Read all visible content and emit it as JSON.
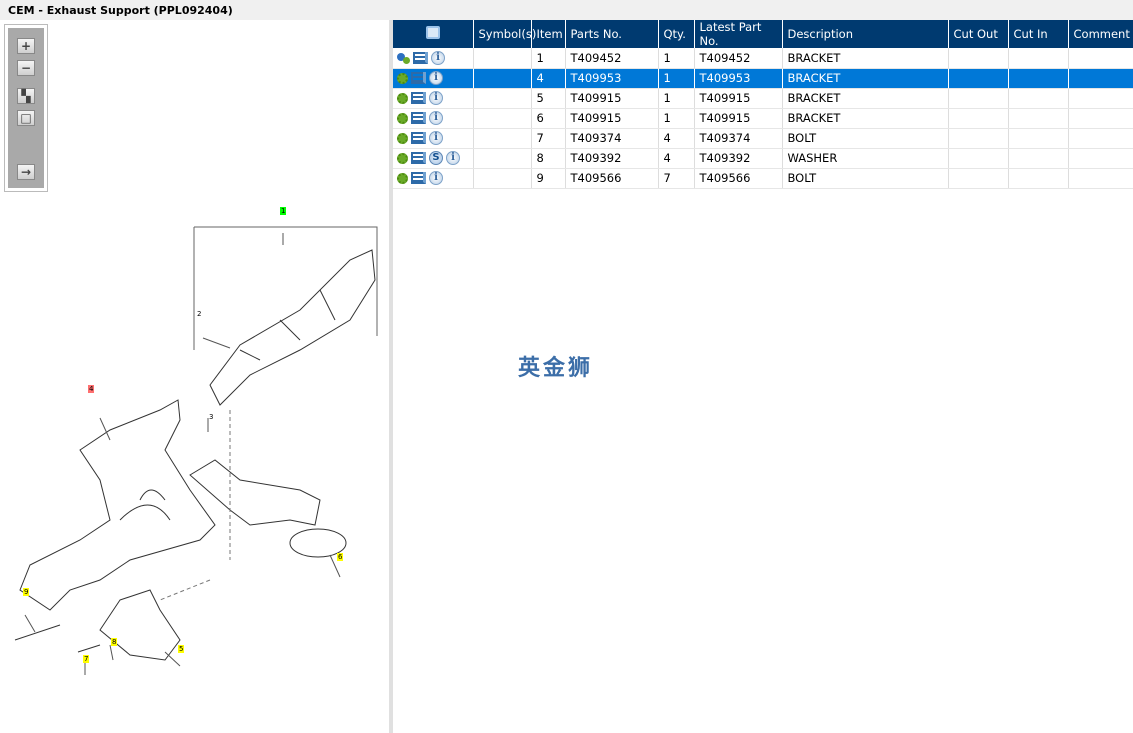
{
  "window": {
    "title": "CEM - Exhaust Support (PPL092404)"
  },
  "toolbar": {
    "buttons": [
      {
        "name": "zoom-in-icon",
        "glyph": "+"
      },
      {
        "name": "zoom-out-icon",
        "glyph": "−"
      },
      {
        "name": "fit-all-icon",
        "glyph": "▚"
      },
      {
        "name": "fit-window-icon",
        "glyph": "□"
      },
      {
        "name": "export-icon",
        "glyph": "→"
      }
    ]
  },
  "diagram": {
    "callouts": [
      {
        "label": "1",
        "color": "#00ff00"
      },
      {
        "label": "2",
        "color": ""
      },
      {
        "label": "3",
        "color": ""
      },
      {
        "label": "4",
        "color": "#ff7070"
      },
      {
        "label": "5",
        "color": "#ffff00"
      },
      {
        "label": "6",
        "color": "#ffff00"
      },
      {
        "label": "7",
        "color": "#ffff00"
      },
      {
        "label": "8",
        "color": "#ffff00"
      },
      {
        "label": "9",
        "color": "#ffff00"
      }
    ]
  },
  "table": {
    "columns": [
      "",
      "Symbol(s)",
      "Item",
      "Parts No.",
      "Qty.",
      "Latest Part No.",
      "Description",
      "Cut Out",
      "Cut In",
      "Comment"
    ],
    "header_icon": "search-parts-icon",
    "rows": [
      {
        "icons": [
          "multi-gear",
          "cart",
          "info"
        ],
        "symbols": "",
        "item": "1",
        "part": "T409452",
        "qty": "1",
        "latest": "T409452",
        "desc": "BRACKET",
        "cut_out": "",
        "cut_in": "",
        "comment": "",
        "selected": false
      },
      {
        "icons": [
          "gear",
          "cart",
          "info"
        ],
        "symbols": "",
        "item": "4",
        "part": "T409953",
        "qty": "1",
        "latest": "T409953",
        "desc": "BRACKET",
        "cut_out": "",
        "cut_in": "",
        "comment": "",
        "selected": true
      },
      {
        "icons": [
          "gear",
          "cart",
          "info"
        ],
        "symbols": "",
        "item": "5",
        "part": "T409915",
        "qty": "1",
        "latest": "T409915",
        "desc": "BRACKET",
        "cut_out": "",
        "cut_in": "",
        "comment": "",
        "selected": false
      },
      {
        "icons": [
          "gear",
          "cart",
          "info"
        ],
        "symbols": "",
        "item": "6",
        "part": "T409915",
        "qty": "1",
        "latest": "T409915",
        "desc": "BRACKET",
        "cut_out": "",
        "cut_in": "",
        "comment": "",
        "selected": false
      },
      {
        "icons": [
          "gear",
          "cart",
          "info"
        ],
        "symbols": "",
        "item": "7",
        "part": "T409374",
        "qty": "4",
        "latest": "T409374",
        "desc": "BOLT",
        "cut_out": "",
        "cut_in": "",
        "comment": "",
        "selected": false
      },
      {
        "icons": [
          "gear",
          "cart",
          "s",
          "info"
        ],
        "symbols": "",
        "item": "8",
        "part": "T409392",
        "qty": "4",
        "latest": "T409392",
        "desc": "WASHER",
        "cut_out": "",
        "cut_in": "",
        "comment": "",
        "selected": false
      },
      {
        "icons": [
          "gear",
          "cart",
          "info"
        ],
        "symbols": "",
        "item": "9",
        "part": "T409566",
        "qty": "7",
        "latest": "T409566",
        "desc": "BOLT",
        "cut_out": "",
        "cut_in": "",
        "comment": "",
        "selected": false
      }
    ]
  },
  "watermark": "英金狮",
  "colors": {
    "header": "#003a70",
    "selected": "#0078d7"
  }
}
